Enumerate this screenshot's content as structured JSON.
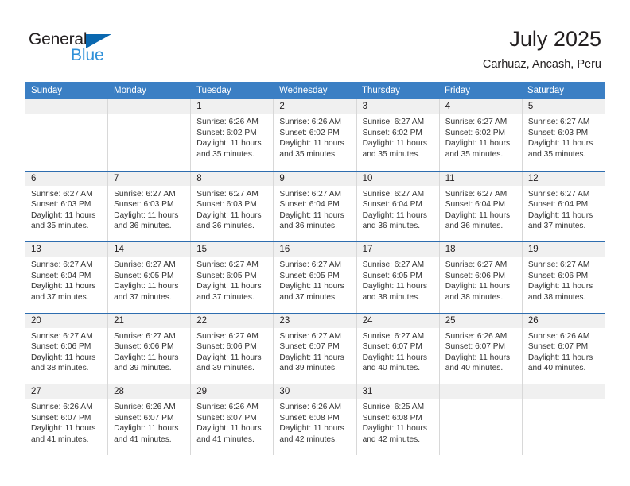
{
  "logo": {
    "word_one": "General",
    "word_two": "Blue",
    "triangle_color": "#0a68b0",
    "blue_text_color": "#2f90d8"
  },
  "header": {
    "title": "July 2025",
    "subtitle": "Carhuaz, Ancash, Peru"
  },
  "theme": {
    "header_blue": "#3b7fc4",
    "row_divider_blue": "#2e6daf",
    "day_band_gray": "#f0f0f0"
  },
  "weekdays": [
    "Sunday",
    "Monday",
    "Tuesday",
    "Wednesday",
    "Thursday",
    "Friday",
    "Saturday"
  ],
  "weeks": [
    {
      "days": [
        {
          "number": "",
          "sunrise": "",
          "sunset": "",
          "daylight": ""
        },
        {
          "number": "",
          "sunrise": "",
          "sunset": "",
          "daylight": ""
        },
        {
          "number": "1",
          "sunrise": "Sunrise: 6:26 AM",
          "sunset": "Sunset: 6:02 PM",
          "daylight": "Daylight: 11 hours and 35 minutes."
        },
        {
          "number": "2",
          "sunrise": "Sunrise: 6:26 AM",
          "sunset": "Sunset: 6:02 PM",
          "daylight": "Daylight: 11 hours and 35 minutes."
        },
        {
          "number": "3",
          "sunrise": "Sunrise: 6:27 AM",
          "sunset": "Sunset: 6:02 PM",
          "daylight": "Daylight: 11 hours and 35 minutes."
        },
        {
          "number": "4",
          "sunrise": "Sunrise: 6:27 AM",
          "sunset": "Sunset: 6:02 PM",
          "daylight": "Daylight: 11 hours and 35 minutes."
        },
        {
          "number": "5",
          "sunrise": "Sunrise: 6:27 AM",
          "sunset": "Sunset: 6:03 PM",
          "daylight": "Daylight: 11 hours and 35 minutes."
        }
      ]
    },
    {
      "days": [
        {
          "number": "6",
          "sunrise": "Sunrise: 6:27 AM",
          "sunset": "Sunset: 6:03 PM",
          "daylight": "Daylight: 11 hours and 35 minutes."
        },
        {
          "number": "7",
          "sunrise": "Sunrise: 6:27 AM",
          "sunset": "Sunset: 6:03 PM",
          "daylight": "Daylight: 11 hours and 36 minutes."
        },
        {
          "number": "8",
          "sunrise": "Sunrise: 6:27 AM",
          "sunset": "Sunset: 6:03 PM",
          "daylight": "Daylight: 11 hours and 36 minutes."
        },
        {
          "number": "9",
          "sunrise": "Sunrise: 6:27 AM",
          "sunset": "Sunset: 6:04 PM",
          "daylight": "Daylight: 11 hours and 36 minutes."
        },
        {
          "number": "10",
          "sunrise": "Sunrise: 6:27 AM",
          "sunset": "Sunset: 6:04 PM",
          "daylight": "Daylight: 11 hours and 36 minutes."
        },
        {
          "number": "11",
          "sunrise": "Sunrise: 6:27 AM",
          "sunset": "Sunset: 6:04 PM",
          "daylight": "Daylight: 11 hours and 36 minutes."
        },
        {
          "number": "12",
          "sunrise": "Sunrise: 6:27 AM",
          "sunset": "Sunset: 6:04 PM",
          "daylight": "Daylight: 11 hours and 37 minutes."
        }
      ]
    },
    {
      "days": [
        {
          "number": "13",
          "sunrise": "Sunrise: 6:27 AM",
          "sunset": "Sunset: 6:04 PM",
          "daylight": "Daylight: 11 hours and 37 minutes."
        },
        {
          "number": "14",
          "sunrise": "Sunrise: 6:27 AM",
          "sunset": "Sunset: 6:05 PM",
          "daylight": "Daylight: 11 hours and 37 minutes."
        },
        {
          "number": "15",
          "sunrise": "Sunrise: 6:27 AM",
          "sunset": "Sunset: 6:05 PM",
          "daylight": "Daylight: 11 hours and 37 minutes."
        },
        {
          "number": "16",
          "sunrise": "Sunrise: 6:27 AM",
          "sunset": "Sunset: 6:05 PM",
          "daylight": "Daylight: 11 hours and 37 minutes."
        },
        {
          "number": "17",
          "sunrise": "Sunrise: 6:27 AM",
          "sunset": "Sunset: 6:05 PM",
          "daylight": "Daylight: 11 hours and 38 minutes."
        },
        {
          "number": "18",
          "sunrise": "Sunrise: 6:27 AM",
          "sunset": "Sunset: 6:06 PM",
          "daylight": "Daylight: 11 hours and 38 minutes."
        },
        {
          "number": "19",
          "sunrise": "Sunrise: 6:27 AM",
          "sunset": "Sunset: 6:06 PM",
          "daylight": "Daylight: 11 hours and 38 minutes."
        }
      ]
    },
    {
      "days": [
        {
          "number": "20",
          "sunrise": "Sunrise: 6:27 AM",
          "sunset": "Sunset: 6:06 PM",
          "daylight": "Daylight: 11 hours and 38 minutes."
        },
        {
          "number": "21",
          "sunrise": "Sunrise: 6:27 AM",
          "sunset": "Sunset: 6:06 PM",
          "daylight": "Daylight: 11 hours and 39 minutes."
        },
        {
          "number": "22",
          "sunrise": "Sunrise: 6:27 AM",
          "sunset": "Sunset: 6:06 PM",
          "daylight": "Daylight: 11 hours and 39 minutes."
        },
        {
          "number": "23",
          "sunrise": "Sunrise: 6:27 AM",
          "sunset": "Sunset: 6:07 PM",
          "daylight": "Daylight: 11 hours and 39 minutes."
        },
        {
          "number": "24",
          "sunrise": "Sunrise: 6:27 AM",
          "sunset": "Sunset: 6:07 PM",
          "daylight": "Daylight: 11 hours and 40 minutes."
        },
        {
          "number": "25",
          "sunrise": "Sunrise: 6:26 AM",
          "sunset": "Sunset: 6:07 PM",
          "daylight": "Daylight: 11 hours and 40 minutes."
        },
        {
          "number": "26",
          "sunrise": "Sunrise: 6:26 AM",
          "sunset": "Sunset: 6:07 PM",
          "daylight": "Daylight: 11 hours and 40 minutes."
        }
      ]
    },
    {
      "days": [
        {
          "number": "27",
          "sunrise": "Sunrise: 6:26 AM",
          "sunset": "Sunset: 6:07 PM",
          "daylight": "Daylight: 11 hours and 41 minutes."
        },
        {
          "number": "28",
          "sunrise": "Sunrise: 6:26 AM",
          "sunset": "Sunset: 6:07 PM",
          "daylight": "Daylight: 11 hours and 41 minutes."
        },
        {
          "number": "29",
          "sunrise": "Sunrise: 6:26 AM",
          "sunset": "Sunset: 6:07 PM",
          "daylight": "Daylight: 11 hours and 41 minutes."
        },
        {
          "number": "30",
          "sunrise": "Sunrise: 6:26 AM",
          "sunset": "Sunset: 6:08 PM",
          "daylight": "Daylight: 11 hours and 42 minutes."
        },
        {
          "number": "31",
          "sunrise": "Sunrise: 6:25 AM",
          "sunset": "Sunset: 6:08 PM",
          "daylight": "Daylight: 11 hours and 42 minutes."
        },
        {
          "number": "",
          "sunrise": "",
          "sunset": "",
          "daylight": ""
        },
        {
          "number": "",
          "sunrise": "",
          "sunset": "",
          "daylight": ""
        }
      ]
    }
  ]
}
